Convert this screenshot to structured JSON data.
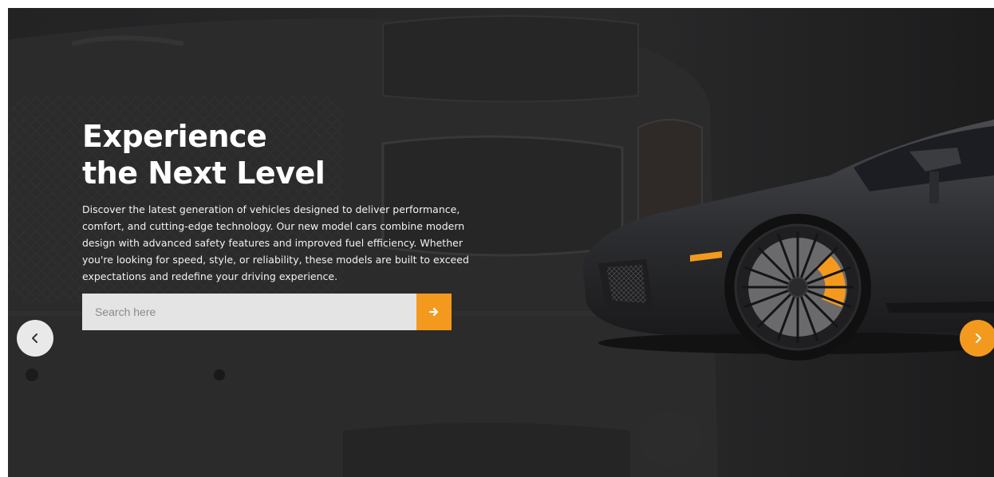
{
  "hero": {
    "headline_line1": "Experience",
    "headline_line2": "the Next Level",
    "description": "Discover the latest generation of vehicles designed to deliver performance, comfort, and cutting-edge technology. Our new model cars combine modern design with advanced safety features and improved fuel efficiency. Whether you're looking for speed, style, or reliability, these models are built to exceed expectations and redefine your driving experience."
  },
  "search": {
    "placeholder": "Search here",
    "button_icon": "arrow-right-icon"
  },
  "carousel": {
    "prev_icon": "chevron-left-icon",
    "next_icon": "chevron-right-icon"
  },
  "colors": {
    "accent": "#f39a1e",
    "background": "#202021",
    "search_field": "#e4e4e4",
    "prev_button": "#e9e9e9",
    "text": "#ffffff"
  }
}
